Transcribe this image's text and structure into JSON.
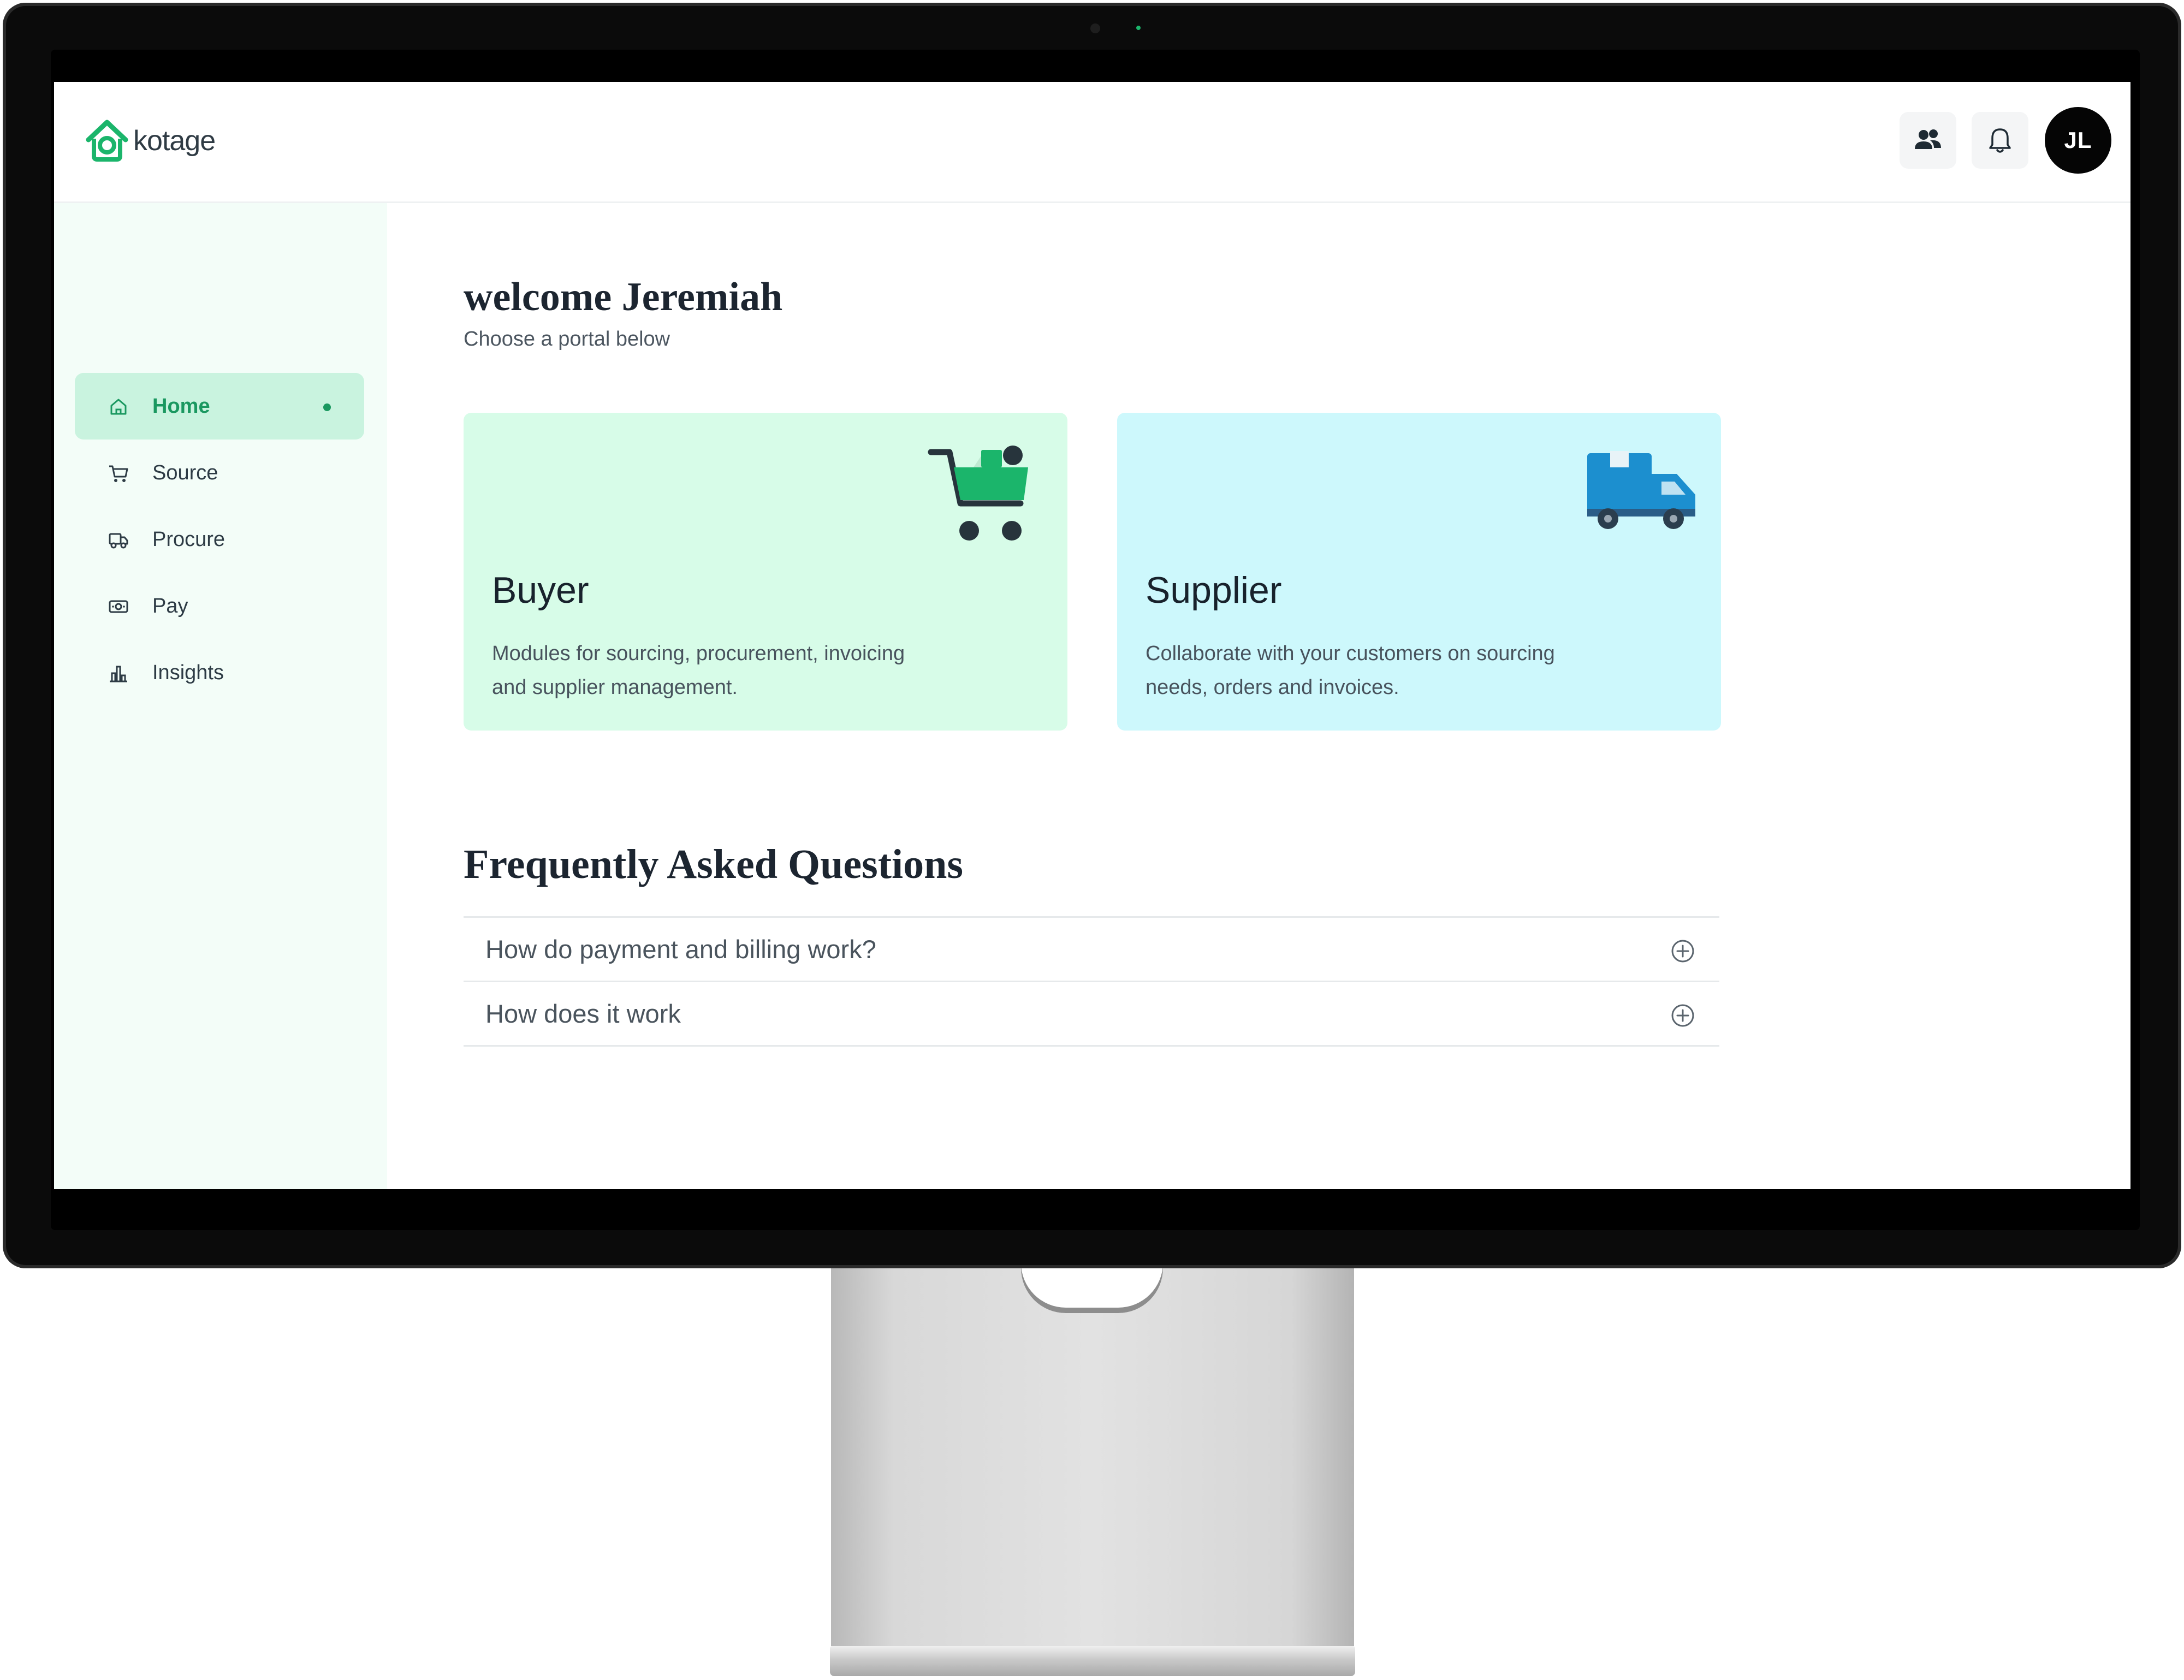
{
  "header": {
    "logo_text": "kotage",
    "avatar_initials": "JL",
    "team_icon": "users-icon",
    "notification_icon": "bell-icon"
  },
  "sidebar": {
    "items": [
      {
        "label": "Home",
        "icon": "home-icon",
        "active": true
      },
      {
        "label": "Source",
        "icon": "cart-icon",
        "active": false
      },
      {
        "label": "Procure",
        "icon": "delivery-icon",
        "active": false
      },
      {
        "label": "Pay",
        "icon": "money-icon",
        "active": false
      },
      {
        "label": "Insights",
        "icon": "bar-chart-icon",
        "active": false
      }
    ]
  },
  "main": {
    "welcome": "welcome Jeremiah",
    "subtitle": "Choose a portal below",
    "cards": [
      {
        "title": "Buyer",
        "description": "Modules for sourcing, procurement, invoicing and supplier management.",
        "icon": "shopping-cart-icon"
      },
      {
        "title": "Supplier",
        "description": "Collaborate with your customers on sourcing needs, orders and invoices.",
        "icon": "truck-icon"
      }
    ],
    "faq": {
      "title": "Frequently Asked Questions",
      "items": [
        {
          "question": "How do payment and billing work?"
        },
        {
          "question": "How does it work"
        }
      ]
    }
  },
  "colors": {
    "accent": "#1a9860",
    "sidebar_bg": "#f3fdf8",
    "active_item_bg": "#c9f3df",
    "buyer_card_bg": "#d7fce8",
    "supplier_card_bg": "#cdf8fc"
  }
}
